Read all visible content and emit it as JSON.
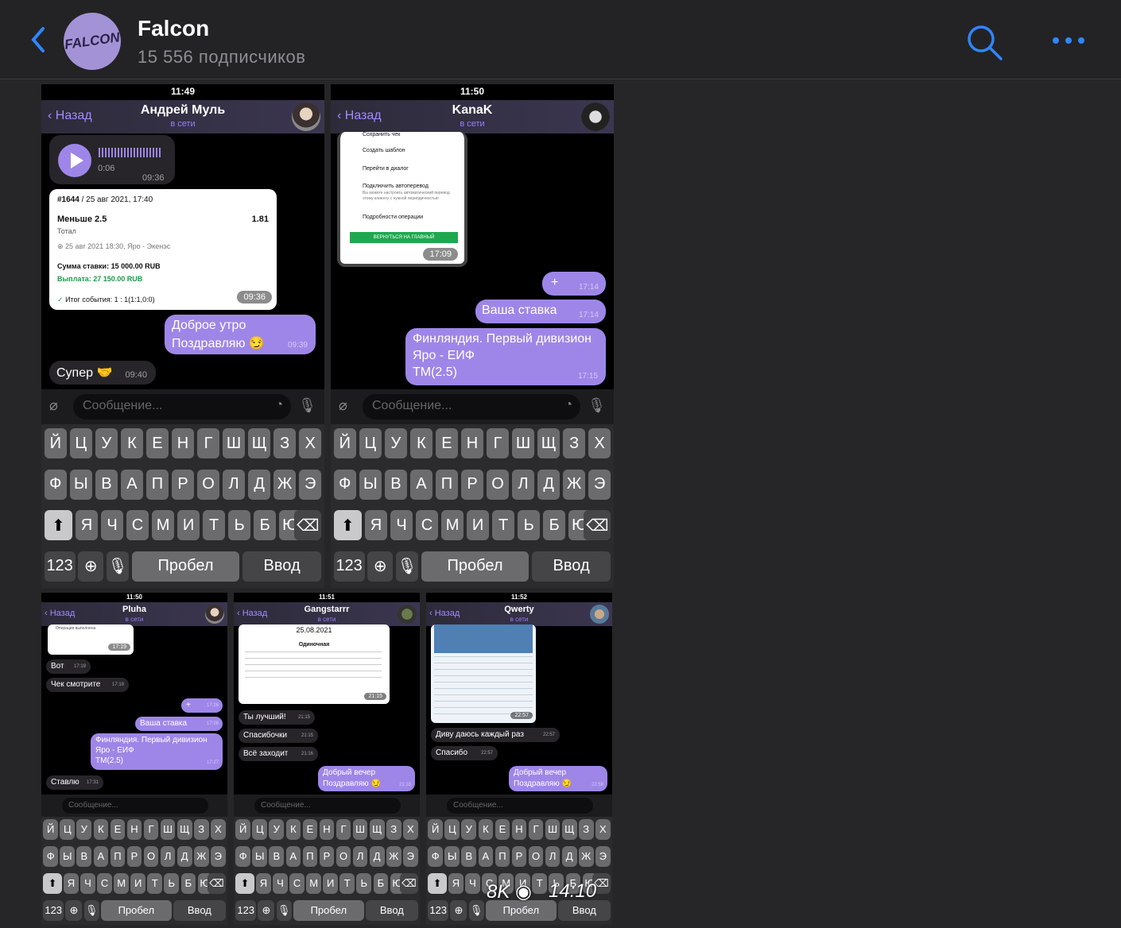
{
  "channel": {
    "name": "Falcon",
    "subscribers": "15 556 подписчиков",
    "avatar_text": "FALCON"
  },
  "colors": {
    "accent": "#2f86ff",
    "bubble_out": "#9e86e8",
    "bubble_in": "#272529"
  },
  "icons": {
    "back": "chevron-left-icon",
    "search": "search-icon",
    "more": "more-icon"
  },
  "common": {
    "back": "Назад",
    "online": "в сети",
    "input_placeholder": "Сообщение...",
    "k123": "123",
    "space": "Пробел",
    "enter": "Ввод"
  },
  "keyboard": {
    "row1": [
      "Й",
      "Ц",
      "У",
      "К",
      "Е",
      "Н",
      "Г",
      "Ш",
      "Щ",
      "З",
      "Х"
    ],
    "row2": [
      "Ф",
      "Ы",
      "В",
      "А",
      "П",
      "Р",
      "О",
      "Л",
      "Д",
      "Ж",
      "Э"
    ],
    "row3": [
      "Я",
      "Ч",
      "С",
      "М",
      "И",
      "Т",
      "Ь",
      "Б",
      "Ю"
    ]
  },
  "shots": [
    {
      "time": "11:49",
      "title": "Андрей Муль",
      "voice_duration": "0:06",
      "voice_time": "09:36",
      "receipt": {
        "id": "#1644",
        "date": " / 25 авг 2021, 17:40",
        "bet": "Меньше 2.5",
        "coef": "1.81",
        "type": "Тотал",
        "event": "25 авг 2021 18:30, Яро - Экенэс",
        "stake": "Сумма ставки: 15 000.00 RUB",
        "payout": "Выплата: 27 150.00 RUB",
        "result": "Итог события: 1 : 1(1:1,0:0)",
        "time": "09:36"
      },
      "msg_out_1": "Доброе утро",
      "msg_out_2": "Поздравляю 😏",
      "msg_out_time": "09:39",
      "msg_in": "Супер 🤝",
      "msg_in_time": "09:40"
    },
    {
      "time": "11:50",
      "title": "KanaK",
      "menu": [
        "Сохранить чек",
        "Создать шаблон",
        "Перейти в диалог",
        "Подключить автоперевод",
        "Вы можете настроить автоматический перевод этому клиенту с нужной периодичностью",
        "Подробности операции",
        "ВЕРНУТЬСЯ НА ГЛАВНЫЙ"
      ],
      "menu_time": "17:09",
      "msg_plus": "+",
      "msg_plus_time": "17:14",
      "msg_stake": "Ваша ставка",
      "msg_stake_time": "17:14",
      "msg_finland_1": "Финляндия. Первый дивизион",
      "msg_finland_2": "Яро - ЕИФ",
      "msg_finland_3": "ТМ(2.5)",
      "msg_finland_time": "17:15"
    },
    {
      "time": "11:50",
      "title": "Pluha",
      "receipt_text": "Операция выполнена",
      "receipt_time": "17:19",
      "msg1": "Вот",
      "msg1_time": "17:19",
      "msg2": "Чек смотрите",
      "msg2_time": "17:19",
      "msg_plus": "+",
      "msg_plus_time": "17:26",
      "msg_stake": "Ваша ставка",
      "msg_stake_time": "17:26",
      "msg_fin_1": "Финляндия. Первый дивизион",
      "msg_fin_2": "Яро - ЕИФ",
      "msg_fin_3": "ТМ(2.5)",
      "msg_fin_time": "17:27",
      "msg_last": "Ставлю",
      "msg_last_time": "17:31"
    },
    {
      "time": "11:51",
      "title": "Gangstarrr",
      "receipt_date": "25.08.2021",
      "receipt_type": "Одиночная",
      "receipt_time": "21:15",
      "msg1": "Ты лучший!",
      "msg1_time": "21:15",
      "msg2": "Спасибочки",
      "msg2_time": "21:15",
      "msg3": "Всё заходит",
      "msg3_time": "21:16",
      "msg_out_1": "Добрый вечер",
      "msg_out_2": "Поздравляю 😏",
      "msg_out_time": "21:18"
    },
    {
      "time": "11:52",
      "title": "Qwerty",
      "receipt_time": "22:57",
      "msg1": "Диву даюсь каждый раз",
      "msg1_time": "22:57",
      "msg2": "Спасибо",
      "msg2_time": "22:57",
      "msg_out_1": "Добрый вечер",
      "msg_out_2": "Поздравляю 😏",
      "msg_out_time": "22:58"
    }
  ],
  "overlay": {
    "views": "8K",
    "time": "14:10"
  }
}
